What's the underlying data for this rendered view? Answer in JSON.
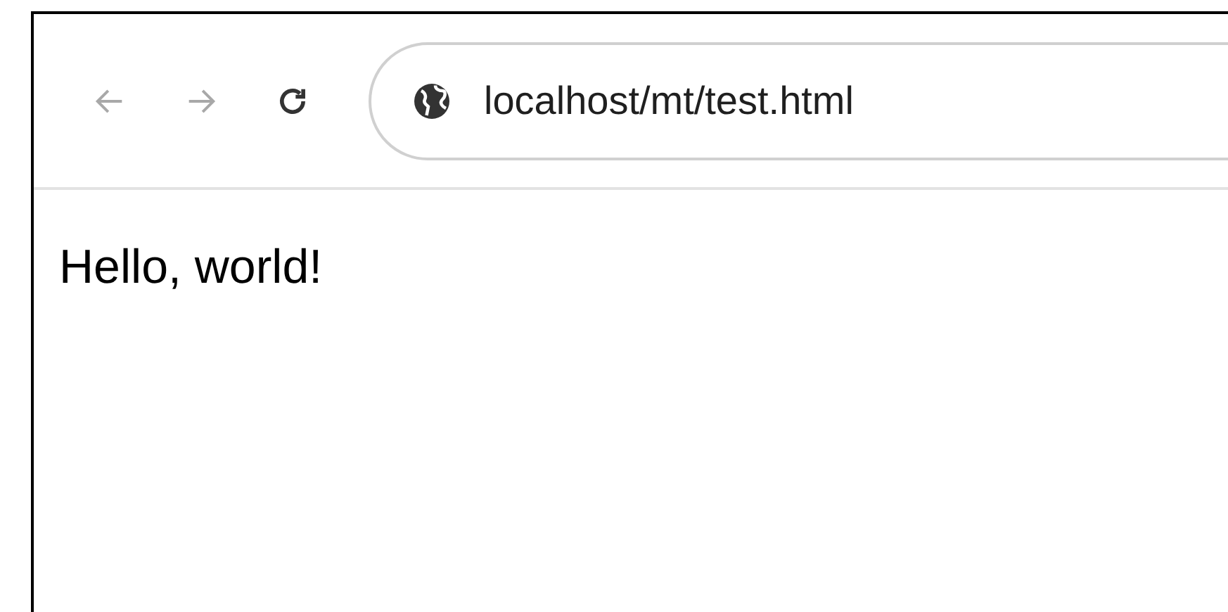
{
  "toolbar": {
    "back": {
      "disabled": true
    },
    "forward": {
      "disabled": true
    },
    "reload": {
      "disabled": false
    }
  },
  "address_bar": {
    "url": "localhost/mt/test.html"
  },
  "page": {
    "text": "Hello, world!"
  }
}
